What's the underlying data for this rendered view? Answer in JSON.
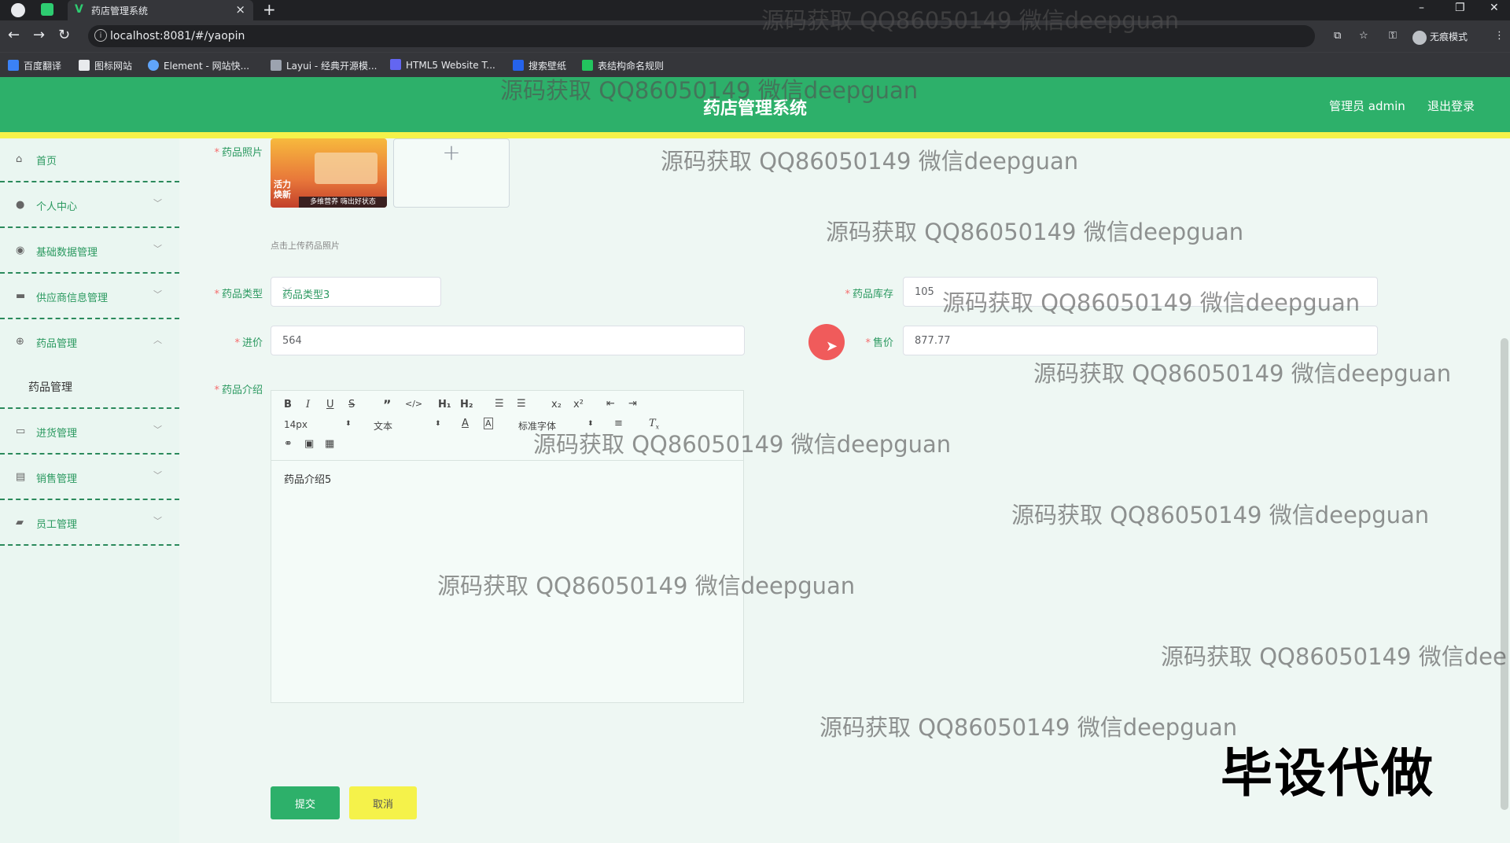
{
  "browser": {
    "tab_title": "药店管理系统",
    "url": "localhost:8081/#/yaopin",
    "profile_label": "无痕模式",
    "bookmarks": [
      "百度翻译",
      "图标网站",
      "Element - 网站快...",
      "Layui - 经典开源模...",
      "HTML5 Website T...",
      "搜索壁纸",
      "表结构命名规则"
    ]
  },
  "header": {
    "title": "药店管理系统",
    "user": "管理员 admin",
    "logout": "退出登录"
  },
  "sidebar": {
    "items": [
      {
        "label": "首页",
        "icon": "home-icon"
      },
      {
        "label": "个人中心",
        "icon": "user-icon"
      },
      {
        "label": "基础数据管理",
        "icon": "data-icon"
      },
      {
        "label": "供应商信息管理",
        "icon": "supplier-icon"
      },
      {
        "label": "药品管理",
        "icon": "drug-icon"
      },
      {
        "label": "进货管理",
        "icon": "purchase-icon"
      },
      {
        "label": "销售管理",
        "icon": "sales-icon"
      },
      {
        "label": "员工管理",
        "icon": "staff-icon"
      }
    ],
    "submenu": "药品管理"
  },
  "form": {
    "photo_label": "药品照片",
    "photo_thumb_text": "活力焕新",
    "photo_thumb_banner": "多维营养 嗨出好状态",
    "upload_hint": "点击上传药品照片",
    "type_label": "药品类型",
    "type_value": "药品类型3",
    "stock_label": "药品库存",
    "stock_value": "105",
    "cost_label": "进价",
    "cost_value": "564",
    "price_label": "售价",
    "price_value": "877.77",
    "intro_label": "药品介绍",
    "font_size": "14px",
    "format": "文本",
    "font_family": "标准字体",
    "intro_content": "药品介绍5",
    "submit": "提交",
    "cancel": "取消"
  },
  "watermark": "源码获取 QQ86050149 微信deepguan",
  "watermark_cut": "源码获取 QQ86050149 微信dee",
  "stamp": "毕设代做",
  "colors": {
    "primary": "#2db06a",
    "accent": "#f5f24a",
    "label": "#2b9960"
  }
}
